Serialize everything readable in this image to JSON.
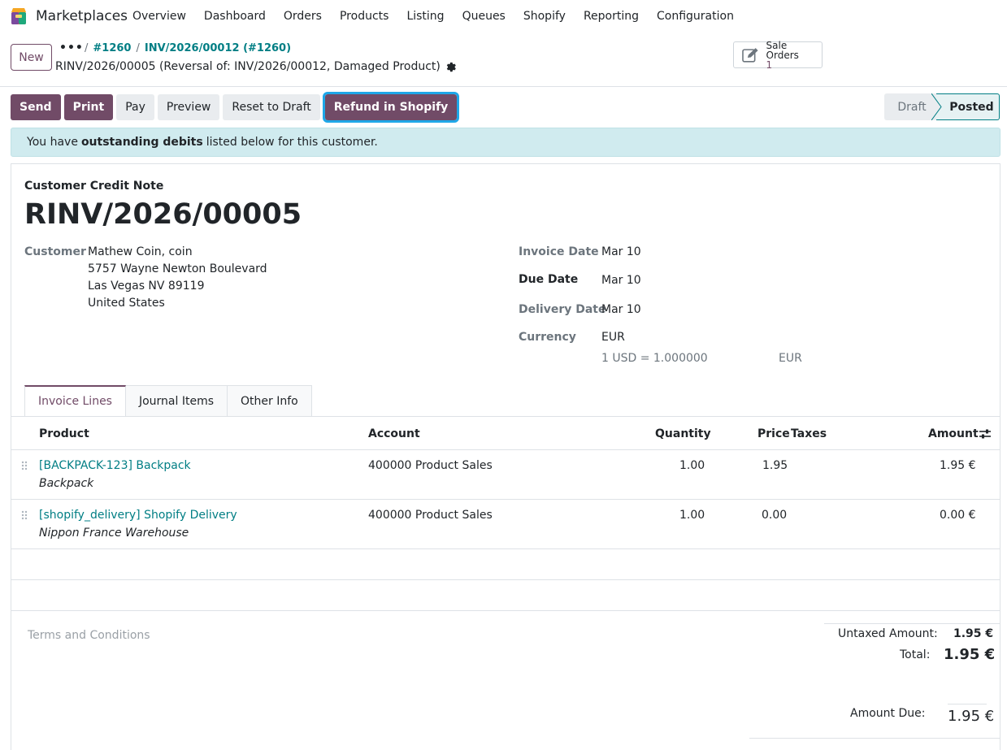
{
  "app": {
    "name": "Marketplaces"
  },
  "menu": [
    "Overview",
    "Dashboard",
    "Orders",
    "Products",
    "Listing",
    "Queues",
    "Shopify",
    "Reporting",
    "Configuration"
  ],
  "control": {
    "new_label": "New",
    "breadcrumb_dots": "•••",
    "breadcrumb_1": "#1260",
    "breadcrumb_2": "INV/2026/00012 (#1260)",
    "record_title": "RINV/2026/00005 (Reversal of: INV/2026/00012, Damaged Product)",
    "smart_button": {
      "label": "Sale Orders",
      "value": "1"
    }
  },
  "actions": {
    "send": "Send",
    "print": "Print",
    "pay": "Pay",
    "preview": "Preview",
    "reset": "Reset to Draft",
    "refund": "Refund in Shopify"
  },
  "status": {
    "draft": "Draft",
    "posted": "Posted"
  },
  "alert": {
    "prefix": "You have",
    "bold": "outstanding debits",
    "suffix": "listed below for this customer."
  },
  "doc": {
    "type": "Customer Credit Note",
    "number": "RINV/2026/00005",
    "customer_label": "Customer",
    "customer_name": "Mathew Coin, coin",
    "address": [
      "5757 Wayne Newton Boulevard",
      "Las Vegas NV 89119",
      "United States"
    ],
    "invoice_date_label": "Invoice Date",
    "invoice_date": "Mar 10",
    "due_date_label": "Due Date",
    "due_date": "Mar 10",
    "delivery_date_label": "Delivery Date",
    "delivery_date": "Mar 10",
    "currency_label": "Currency",
    "currency": "EUR",
    "rate": "1 USD = 1.000000",
    "rate_currency": "EUR"
  },
  "tabs": [
    "Invoice Lines",
    "Journal Items",
    "Other Info"
  ],
  "table": {
    "headers": {
      "product": "Product",
      "account": "Account",
      "quantity": "Quantity",
      "price": "Price",
      "taxes": "Taxes",
      "amount": "Amount"
    },
    "rows": [
      {
        "product": "[BACKPACK-123] Backpack",
        "description": "Backpack",
        "account": "400000 Product Sales",
        "quantity": "1.00",
        "price": "1.95",
        "amount": "1.95 €"
      },
      {
        "product": "[shopify_delivery] Shopify Delivery",
        "description": "Nippon France Warehouse",
        "account": "400000 Product Sales",
        "quantity": "1.00",
        "price": "0.00",
        "amount": "0.00 €"
      }
    ]
  },
  "footer": {
    "terms": "Terms and Conditions",
    "untaxed_label": "Untaxed Amount:",
    "untaxed_value": "1.95 €",
    "total_label": "Total:",
    "total_value": "1.95 €",
    "due_label": "Amount Due:",
    "due_value": "1.95 €"
  },
  "colors": {
    "brand": "#714b67",
    "link": "#017e84",
    "alert_bg": "#d0ebef",
    "focus": "#1ea7e8"
  }
}
